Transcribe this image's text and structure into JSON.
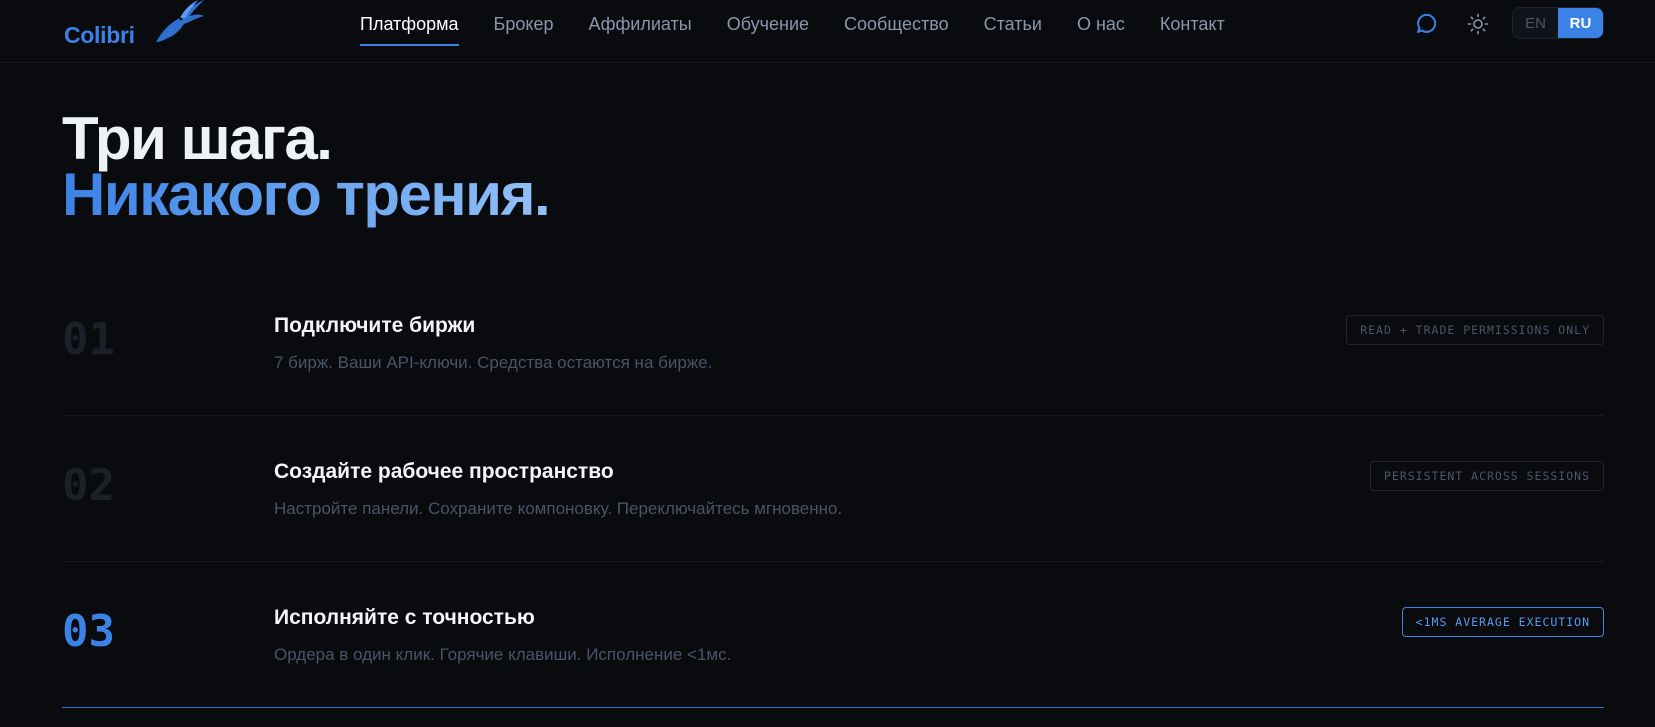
{
  "brand": {
    "name": "Colibri"
  },
  "nav": {
    "items": [
      {
        "label": "Платформа",
        "active": true
      },
      {
        "label": "Брокер"
      },
      {
        "label": "Аффилиаты"
      },
      {
        "label": "Обучение"
      },
      {
        "label": "Сообщество"
      },
      {
        "label": "Статьи"
      },
      {
        "label": "О нас"
      },
      {
        "label": "Контакт"
      }
    ]
  },
  "header_actions": {
    "chat_icon": "chat-bubble-icon",
    "theme_icon": "sun-icon",
    "languages": [
      {
        "code": "EN",
        "selected": false
      },
      {
        "code": "RU",
        "selected": true
      }
    ]
  },
  "hero": {
    "line1": "Три шага.",
    "line2": "Никакого трения."
  },
  "steps": [
    {
      "number": "01",
      "title": "Подключите биржи",
      "description": "7 бирж. Ваши API-ключи. Средства остаются на бирже.",
      "badge": "READ + TRADE PERMISSIONS ONLY",
      "active": false
    },
    {
      "number": "02",
      "title": "Создайте рабочее пространство",
      "description": "Настройте панели. Сохраните компоновку. Переключайтесь мгновенно.",
      "badge": "PERSISTENT ACROSS SESSIONS",
      "active": false
    },
    {
      "number": "03",
      "title": "Исполняйте с точностью",
      "description": "Ордера в один клик. Горячие клавиши. Исполнение <1мс.",
      "badge": "<1MS AVERAGE EXECUTION",
      "active": true
    }
  ],
  "colors": {
    "background": "#090b0f",
    "accent": "#3b82e6",
    "muted_text": "#4a5468"
  }
}
